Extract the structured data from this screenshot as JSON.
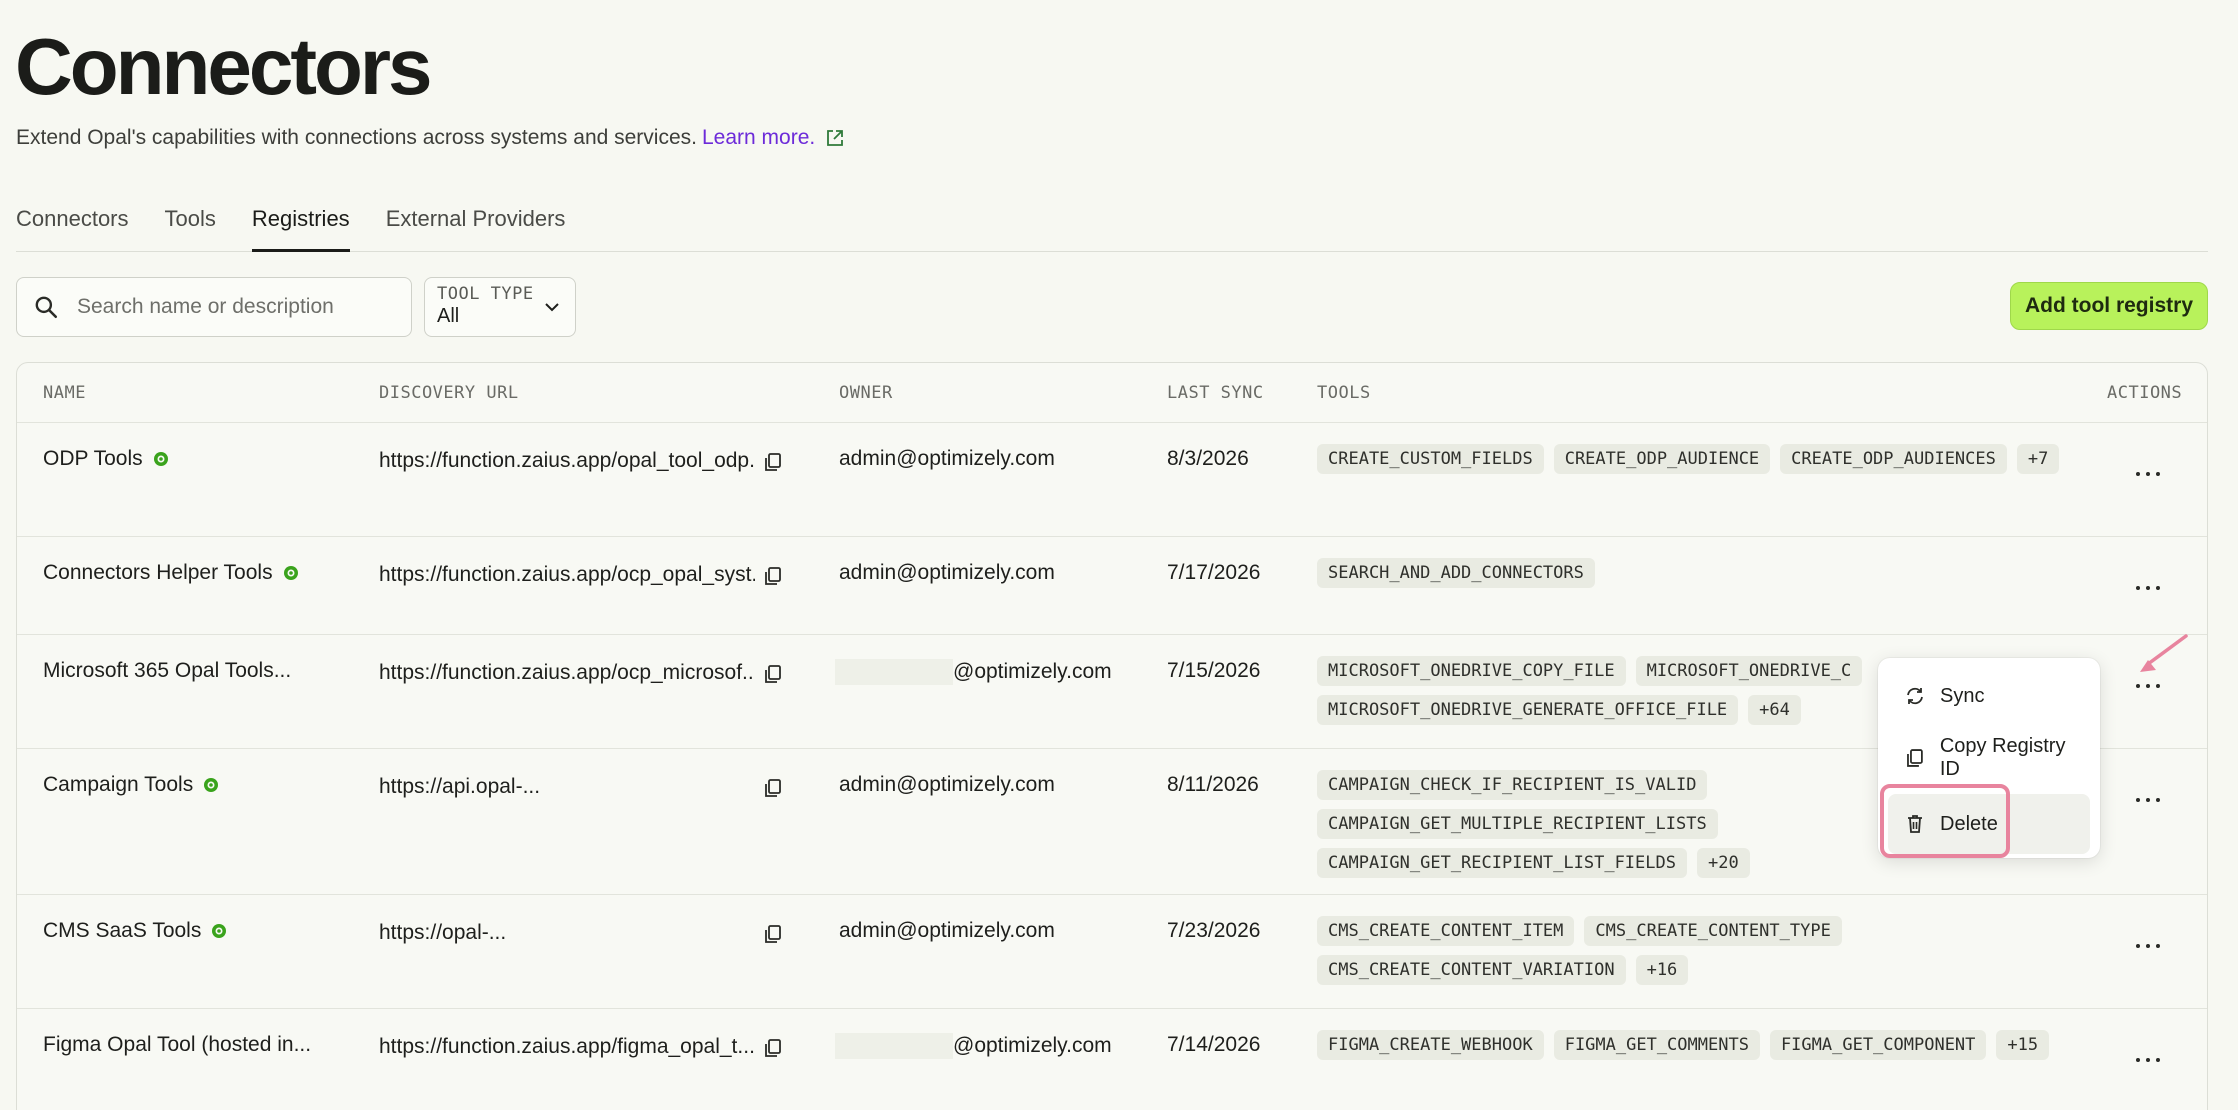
{
  "header": {
    "title": "Connectors",
    "subtitle": "Extend Opal's capabilities with connections across systems and services.",
    "learn_more": "Learn more."
  },
  "tabs": [
    {
      "label": "Connectors",
      "active": false
    },
    {
      "label": "Tools",
      "active": false
    },
    {
      "label": "Registries",
      "active": true
    },
    {
      "label": "External Providers",
      "active": false
    }
  ],
  "search": {
    "placeholder": "Search name or description"
  },
  "filter": {
    "label": "TOOL TYPE",
    "value": "All"
  },
  "add_button": "Add tool registry",
  "columns": {
    "name": "NAME",
    "url": "DISCOVERY URL",
    "owner": "OWNER",
    "sync": "LAST SYNC",
    "tools": "TOOLS",
    "actions": "ACTIONS"
  },
  "rows": [
    {
      "name": "ODP Tools",
      "url": "https://function.zaius.app/opal_tool_odp...",
      "owner": "admin@optimizely.com",
      "sync": "8/3/2026",
      "tools": [
        "CREATE_CUSTOM_FIELDS",
        "CREATE_ODP_AUDIENCE",
        "CREATE_ODP_AUDIENCES",
        "+7"
      ]
    },
    {
      "name": "Connectors Helper Tools",
      "url": "https://function.zaius.app/ocp_opal_syst...",
      "owner": "admin@optimizely.com",
      "sync": "7/17/2026",
      "tools": [
        "SEARCH_AND_ADD_CONNECTORS"
      ]
    },
    {
      "name": "Microsoft 365 Opal Tools...",
      "url": "https://function.zaius.app/ocp_microsof...",
      "owner": "@optimizely.com",
      "sync": "7/15/2026",
      "tools": [
        "MICROSOFT_ONEDRIVE_COPY_FILE",
        "MICROSOFT_ONEDRIVE_C",
        "MICROSOFT_ONEDRIVE_GENERATE_OFFICE_FILE",
        "+64"
      ]
    },
    {
      "name": "Campaign Tools",
      "url": "https://api.opal-...",
      "owner": "admin@optimizely.com",
      "sync": "8/11/2026",
      "tools": [
        "CAMPAIGN_CHECK_IF_RECIPIENT_IS_VALID",
        "CAMPAIGN_GET_MULTIPLE_RECIPIENT_LISTS",
        "CAMPAIGN_GET_RECIPIENT_LIST_FIELDS",
        "+20"
      ]
    },
    {
      "name": "CMS SaaS Tools",
      "url": "https://opal-...",
      "owner": "admin@optimizely.com",
      "sync": "7/23/2026",
      "tools": [
        "CMS_CREATE_CONTENT_ITEM",
        "CMS_CREATE_CONTENT_TYPE",
        "CMS_CREATE_CONTENT_VARIATION",
        "+16"
      ]
    },
    {
      "name": "Figma Opal Tool (hosted in...",
      "url": "https://function.zaius.app/figma_opal_t...",
      "owner": "@optimizely.com",
      "sync": "7/14/2026",
      "tools": [
        "FIGMA_CREATE_WEBHOOK",
        "FIGMA_GET_COMMENTS",
        "FIGMA_GET_COMPONENT",
        "+15"
      ]
    }
  ],
  "menu": {
    "sync": "Sync",
    "copy_id": "Copy Registry ID",
    "delete": "Delete"
  },
  "colors": {
    "accent_button": "#b8f25b",
    "link": "#6d2bd9",
    "highlight": "#e8849e",
    "badge_green": "#3aa31c"
  }
}
